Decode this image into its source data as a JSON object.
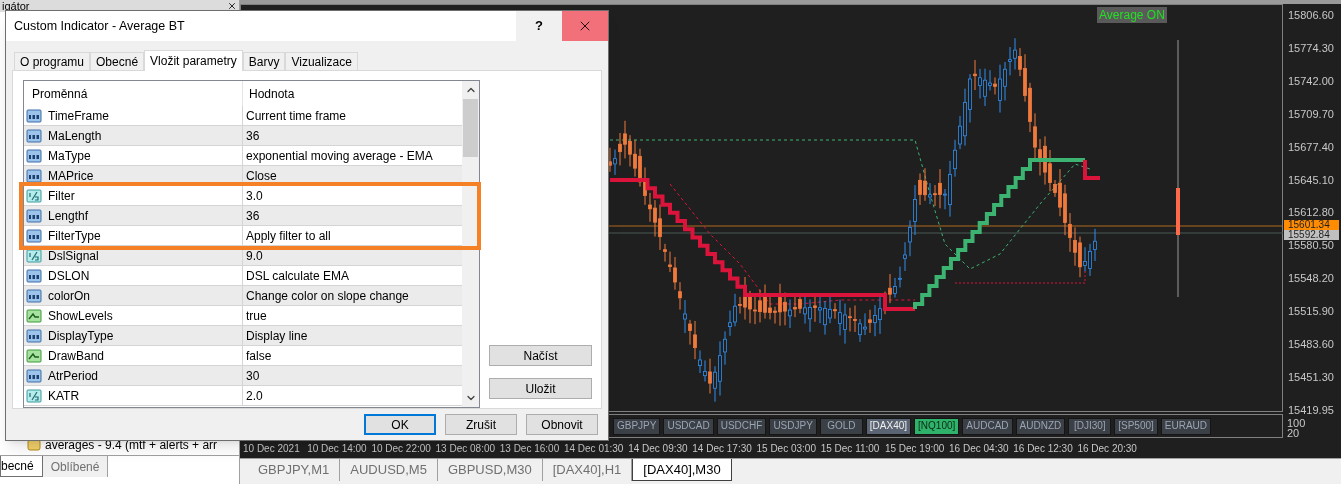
{
  "navigator": {
    "title": "igátor",
    "item": "averages - 9.4 (mtf + alerts + arr",
    "tabs": [
      {
        "label": "becné",
        "selected": true
      },
      {
        "label": "Oblíbené",
        "selected": false
      }
    ]
  },
  "chart": {
    "indicator_label": "Average ON",
    "price_axis": [
      "15806.60",
      "15774.30",
      "15742.00",
      "15709.70",
      "15677.40",
      "15645.10",
      "15612.80",
      "15580.50",
      "15548.20",
      "15515.90",
      "15483.60",
      "15451.30",
      "15419.95"
    ],
    "price_tags": [
      {
        "text": "15601.34",
        "kind": "bid"
      },
      {
        "text": "15592.84",
        "kind": "ask"
      }
    ],
    "subwindow_scale": [
      "100",
      "20"
    ],
    "symbol_buttons": [
      {
        "label": "GBPJPY",
        "kind": "plain"
      },
      {
        "label": "USDCAD",
        "kind": "plain"
      },
      {
        "label": "USDCHF",
        "kind": "plain"
      },
      {
        "label": "USDJPY",
        "kind": "plain"
      },
      {
        "label": "GOLD",
        "kind": "plain"
      },
      {
        "label": "[DAX40]",
        "kind": "current"
      },
      {
        "label": "[NQ100]",
        "kind": "active"
      },
      {
        "label": "AUDCAD",
        "kind": "plain"
      },
      {
        "label": "AUDNZD",
        "kind": "plain"
      },
      {
        "label": "[DJI30]",
        "kind": "plain"
      },
      {
        "label": "[SP500]",
        "kind": "plain"
      },
      {
        "label": "EURAUD",
        "kind": "plain"
      }
    ],
    "time_axis": [
      "10 Dec 2021",
      "10 Dec 14:00",
      "10 Dec 22:00",
      "13 Dec 08:00",
      "13 Dec 16:00",
      "14 Dec 01:30",
      "14 Dec 09:30",
      "14 Dec 17:30",
      "15 Dec 03:00",
      "15 Dec 11:00",
      "15 Dec 19:00",
      "16 Dec 04:30",
      "16 Dec 12:30",
      "16 Dec 20:30"
    ]
  },
  "chart_tabs": [
    {
      "label": "GBPJPY,M1",
      "selected": false
    },
    {
      "label": "AUDUSD,M5",
      "selected": false
    },
    {
      "label": "GBPUSD,M30",
      "selected": false
    },
    {
      "label": "[DAX40],H1",
      "selected": false
    },
    {
      "label": "[DAX40],M30",
      "selected": true
    }
  ],
  "dialog": {
    "title": "Custom Indicator - Average BT",
    "help": "?",
    "tabs": [
      {
        "label": "O programu",
        "selected": false
      },
      {
        "label": "Obecné",
        "selected": false
      },
      {
        "label": "Vložit parametry",
        "selected": true
      },
      {
        "label": "Barvy",
        "selected": false
      },
      {
        "label": "Vizualizace",
        "selected": false
      }
    ],
    "columns": [
      "Proměnná",
      "Hodnota"
    ],
    "params": [
      {
        "name": "TimeFrame",
        "value": "Current time frame",
        "kind": "int",
        "highlighted": false
      },
      {
        "name": "MaLength",
        "value": "36",
        "kind": "int",
        "highlighted": false
      },
      {
        "name": "MaType",
        "value": "exponential moving average - EMA",
        "kind": "int",
        "highlighted": false
      },
      {
        "name": "MAPrice",
        "value": "Close",
        "kind": "int",
        "highlighted": false
      },
      {
        "name": "Filter",
        "value": "3.0",
        "kind": "double",
        "highlighted": true
      },
      {
        "name": "Lengthf",
        "value": "36",
        "kind": "int",
        "highlighted": true
      },
      {
        "name": "FilterType",
        "value": "Apply filter to all",
        "kind": "int",
        "highlighted": true
      },
      {
        "name": "DslSignal",
        "value": "9.0",
        "kind": "double",
        "highlighted": false
      },
      {
        "name": "DSLON",
        "value": "DSL calculate EMA",
        "kind": "int",
        "highlighted": false
      },
      {
        "name": "colorOn",
        "value": "Change color on slope change",
        "kind": "int",
        "highlighted": false
      },
      {
        "name": "ShowLevels",
        "value": "true",
        "kind": "bool",
        "highlighted": false
      },
      {
        "name": "DisplayType",
        "value": "Display line",
        "kind": "int",
        "highlighted": false
      },
      {
        "name": "DrawBand",
        "value": "false",
        "kind": "bool",
        "highlighted": false
      },
      {
        "name": "AtrPeriod",
        "value": "30",
        "kind": "int",
        "highlighted": false
      },
      {
        "name": "KATR",
        "value": "2.0",
        "kind": "double",
        "highlighted": false
      }
    ],
    "side_buttons": [
      "Načíst",
      "Uložit"
    ],
    "buttons": [
      {
        "label": "OK",
        "default": true
      },
      {
        "label": "Zrušit",
        "default": false
      },
      {
        "label": "Obnovit",
        "default": false
      }
    ]
  }
}
